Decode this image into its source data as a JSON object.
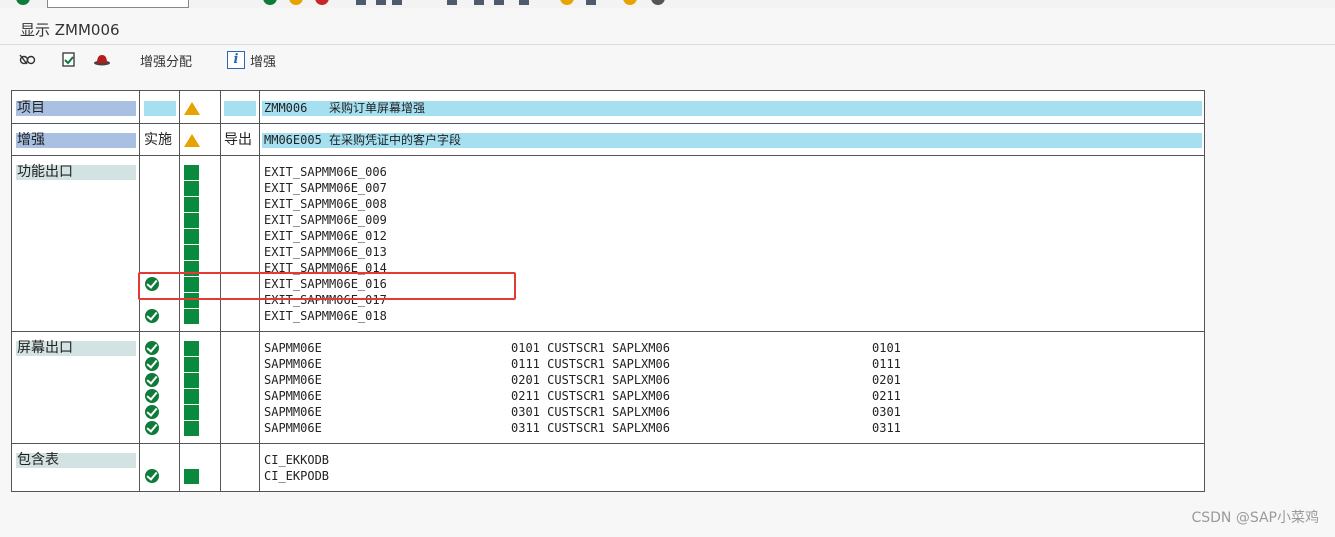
{
  "window": {
    "title": "显示 ZMM006"
  },
  "app_toolbar": {
    "enhancement_assign_label": "增强分配",
    "enhancement_label": "增强"
  },
  "header_rows": {
    "project": {
      "label": "项目",
      "value": "ZMM006   采购订单屏幕增强"
    },
    "enhancement": {
      "label": "增强",
      "impl_label": "实施",
      "export_label": "导出",
      "value": "MM06E005 在采购凭证中的客户字段"
    }
  },
  "function_exits": {
    "label": "功能出口",
    "items": [
      {
        "name": "EXIT_SAPMM06E_006",
        "implemented": false
      },
      {
        "name": "EXIT_SAPMM06E_007",
        "implemented": false
      },
      {
        "name": "EXIT_SAPMM06E_008",
        "implemented": false
      },
      {
        "name": "EXIT_SAPMM06E_009",
        "implemented": false
      },
      {
        "name": "EXIT_SAPMM06E_012",
        "implemented": false
      },
      {
        "name": "EXIT_SAPMM06E_013",
        "implemented": false
      },
      {
        "name": "EXIT_SAPMM06E_014",
        "implemented": false
      },
      {
        "name": "EXIT_SAPMM06E_016",
        "implemented": true
      },
      {
        "name": "EXIT_SAPMM06E_017",
        "implemented": false
      },
      {
        "name": "EXIT_SAPMM06E_018",
        "implemented": true
      }
    ]
  },
  "screen_exits": {
    "label": "屏幕出口",
    "items": [
      {
        "program": "SAPMM06E",
        "detail": "0101 CUSTSCR1 SAPLXM06",
        "screen": "0101"
      },
      {
        "program": "SAPMM06E",
        "detail": "0111 CUSTSCR1 SAPLXM06",
        "screen": "0111"
      },
      {
        "program": "SAPMM06E",
        "detail": "0201 CUSTSCR1 SAPLXM06",
        "screen": "0201"
      },
      {
        "program": "SAPMM06E",
        "detail": "0211 CUSTSCR1 SAPLXM06",
        "screen": "0211"
      },
      {
        "program": "SAPMM06E",
        "detail": "0301 CUSTSCR1 SAPLXM06",
        "screen": "0301"
      },
      {
        "program": "SAPMM06E",
        "detail": "0311 CUSTSCR1 SAPLXM06",
        "screen": "0311"
      }
    ]
  },
  "includes": {
    "label": "包含表",
    "items": [
      {
        "name": "CI_EKKODB",
        "implemented": false
      },
      {
        "name": "CI_EKPODB",
        "implemented": true
      }
    ]
  },
  "watermark": "CSDN @SAP小菜鸡",
  "colors": {
    "accent_green": "#0a8a3f",
    "highlight_red": "#e53935",
    "cyan": "#a5e0f1",
    "label_blue": "#a9c0e3"
  }
}
